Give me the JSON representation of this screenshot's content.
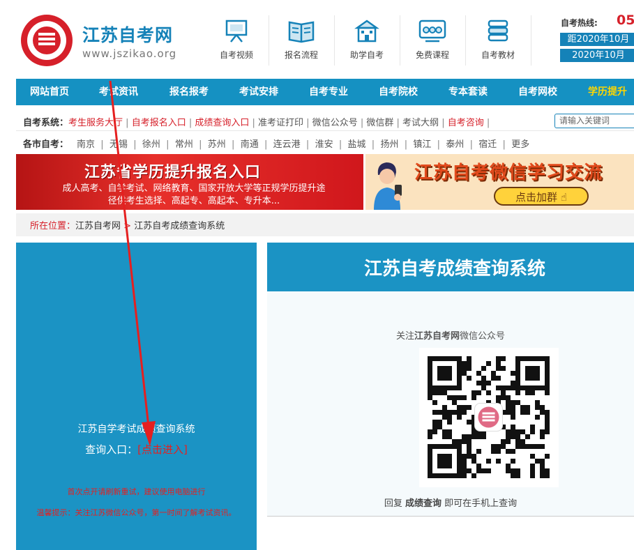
{
  "header": {
    "site_name": "江苏自考网",
    "site_url": "www.jszikao.org",
    "nav": [
      {
        "label": "自考视频",
        "icon": "presentation-board-icon"
      },
      {
        "label": "报名流程",
        "icon": "open-book-icon"
      },
      {
        "label": "助学自考",
        "icon": "school-building-icon"
      },
      {
        "label": "免费课程",
        "icon": "online-class-icon"
      },
      {
        "label": "自考教材",
        "icon": "stacked-books-icon"
      }
    ],
    "hotline_label": "自考热线:",
    "hotline_number": "05",
    "date_line_1": "距2020年10月",
    "date_line_2": "2020年10月"
  },
  "main_nav": [
    "网站首页",
    "考试资讯",
    "报名报考",
    "考试安排",
    "自考专业",
    "自考院校",
    "专本套读",
    "自考网校",
    "学历提升"
  ],
  "system_row": {
    "label": "自考系统：",
    "links": [
      {
        "text": "考生服务大厅",
        "color": "#d6202a"
      },
      {
        "text": "自考报名入口",
        "color": "#d6202a"
      },
      {
        "text": "成绩查询入口",
        "color": "#d6202a"
      },
      {
        "text": "准考证打印",
        "color": "#555555"
      },
      {
        "text": "微信公众号",
        "color": "#555555"
      },
      {
        "text": "微信群",
        "color": "#555555"
      },
      {
        "text": "考试大纲",
        "color": "#555555"
      },
      {
        "text": "自考咨询",
        "color": "#d6202a"
      }
    ],
    "search_placeholder": "请输入关键词"
  },
  "city_row": {
    "label": "各市自考：",
    "cities": [
      "南京",
      "无锡",
      "徐州",
      "常州",
      "苏州",
      "南通",
      "连云港",
      "淮安",
      "盐城",
      "扬州",
      "镇江",
      "泰州",
      "宿迁",
      "更多"
    ]
  },
  "banner_left": {
    "title": "江苏省学历提升报名入口",
    "line_1": "成人高考、自学考试、网络教育、国家开放大学等正规学历提升途",
    "line_2": "径供考生选择、高起专、高起本、专升本..."
  },
  "banner_right": {
    "title": "江苏自考微信学习交流",
    "button": "点击加群"
  },
  "breadcrumb": {
    "label": "所在位置：",
    "home": "江苏自考网",
    "arrow": " > ",
    "current": "江苏自考成绩查询系统"
  },
  "left_panel": {
    "title": "江苏自学考试成绩查询系统",
    "entry_label": "查询入口：",
    "entry_link": "[点击进入]",
    "note_1": "首次点开请刷新重试，建议使用电脑进行",
    "note_2": "温馨提示：关注江苏微信公众号，第一时间了解考试资讯。"
  },
  "right_panel": {
    "title": "江苏自考成绩查询系统",
    "wechat_prefix": "关注",
    "wechat_name": "江苏自考网",
    "wechat_suffix": "微信公众号",
    "caption_prefix": "回复 ",
    "caption_keyword": "成绩查询",
    "caption_suffix": " 即可在手机上查询"
  },
  "colors": {
    "brand_blue": "#1591c2",
    "accent_red": "#d6202a",
    "active_nav_text": "#ffd700"
  }
}
